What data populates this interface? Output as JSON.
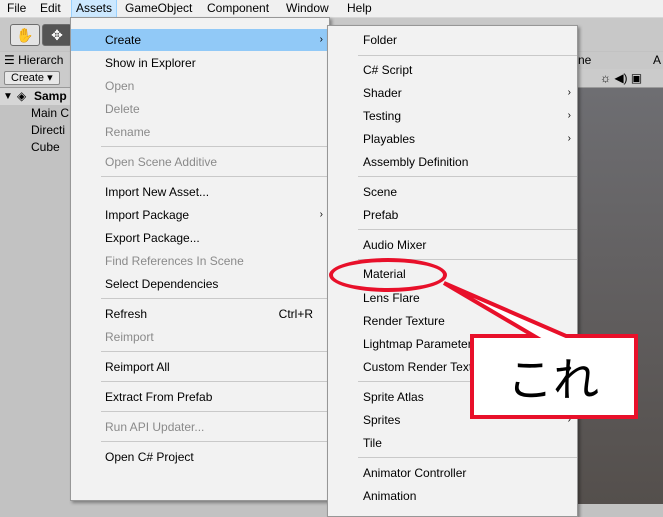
{
  "menubar": {
    "items": [
      "File",
      "Edit",
      "Assets",
      "GameObject",
      "Component",
      "Window",
      "Help"
    ]
  },
  "hierarchy": {
    "tab_label": "☰ Hierarch",
    "create_label": "Create ▾",
    "scene_label": "Samp",
    "rows": [
      "Main C",
      "Directi",
      "Cube"
    ]
  },
  "scene": {
    "tab_label": "ne",
    "tab_label2": "A",
    "toolbar_text": "☼  ◀) ▣"
  },
  "assets_menu": {
    "items": [
      {
        "label": "Create",
        "state": "highlight",
        "arrow": "›"
      },
      {
        "label": "Show in Explorer"
      },
      {
        "label": "Open",
        "state": "disabled"
      },
      {
        "label": "Delete",
        "state": "disabled"
      },
      {
        "label": "Rename",
        "state": "disabled"
      },
      {
        "label": "Open Scene Additive",
        "state": "disabled"
      },
      {
        "label": "Import New Asset..."
      },
      {
        "label": "Import Package",
        "arrow": "›"
      },
      {
        "label": "Export Package..."
      },
      {
        "label": "Find References In Scene",
        "state": "disabled"
      },
      {
        "label": "Select Dependencies"
      },
      {
        "label": "Refresh",
        "shortcut": "Ctrl+R"
      },
      {
        "label": "Reimport",
        "state": "disabled"
      },
      {
        "label": "Reimport All"
      },
      {
        "label": "Extract From Prefab"
      },
      {
        "label": "Run API Updater...",
        "state": "disabled"
      },
      {
        "label": "Open C# Project"
      }
    ]
  },
  "create_menu": {
    "items": [
      {
        "label": "Folder"
      },
      {
        "label": "C# Script"
      },
      {
        "label": "Shader",
        "arrow": "›"
      },
      {
        "label": "Testing",
        "arrow": "›"
      },
      {
        "label": "Playables",
        "arrow": "›"
      },
      {
        "label": "Assembly Definition"
      },
      {
        "label": "Scene"
      },
      {
        "label": "Prefab"
      },
      {
        "label": "Audio Mixer"
      },
      {
        "label": "Material"
      },
      {
        "label": "Lens Flare"
      },
      {
        "label": "Render Texture"
      },
      {
        "label": "Lightmap Parameters"
      },
      {
        "label": "Custom Render Texture"
      },
      {
        "label": "Sprite Atlas"
      },
      {
        "label": "Sprites",
        "arrow": "›"
      },
      {
        "label": "Tile"
      },
      {
        "label": "Animator Controller"
      },
      {
        "label": "Animation"
      }
    ]
  },
  "annotation": {
    "callout_text": "これ",
    "color": "#e8102a"
  }
}
